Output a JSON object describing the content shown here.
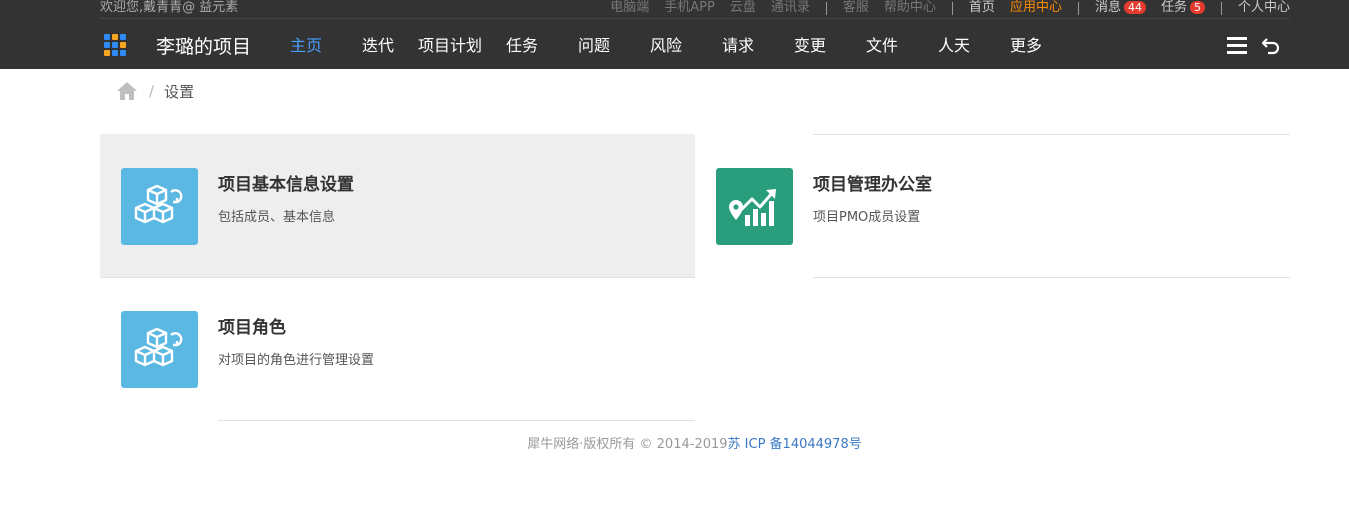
{
  "header": {
    "welcome": "欢迎您,戴青青@ 益元素",
    "links_group1": [
      "电脑端",
      "手机APP",
      "云盘",
      "通讯录"
    ],
    "links_group2": [
      "客服",
      "帮助中心"
    ],
    "home": "首页",
    "app_center": "应用中心",
    "messages_label": "消息",
    "messages_count": "44",
    "tasks_label": "任务",
    "tasks_count": "5",
    "personal_center": "个人中心"
  },
  "nav": {
    "project_title": "李璐的项目",
    "items": [
      "主页",
      "迭代",
      "项目计划",
      "任务",
      "问题",
      "风险",
      "请求",
      "变更",
      "文件",
      "人天",
      "更多"
    ],
    "active_index": 0,
    "grid_icon_colors": [
      "#2f8bf5",
      "#f5a623",
      "#2f8bf5",
      "#2f8bf5",
      "#2f8bf5",
      "#f5a623",
      "#f5a623",
      "#2f8bf5",
      "#2f8bf5"
    ]
  },
  "breadcrumb": {
    "sep": "/",
    "current": "设置"
  },
  "cards": [
    {
      "title": "项目基本信息设置",
      "desc": "包括成员、基本信息",
      "icon": "cubes-icon",
      "color": "#5bb8e3"
    },
    {
      "title": "项目管理办公室",
      "desc": "项目PMO成员设置",
      "icon": "chart-pin-icon",
      "color": "#2a9d7c"
    },
    {
      "title": "项目角色",
      "desc": "对项目的角色进行管理设置",
      "icon": "cubes-icon",
      "color": "#5bb8e3"
    }
  ],
  "footer": {
    "text": "犀牛网络·版权所有 © 2014-2019",
    "icp": "苏 ICP 备14044978号"
  },
  "colors": {
    "topbar_bg": "#333333",
    "nav_active": "#4a9eff",
    "app_center": "#ff8a00",
    "badge": "#e53b2f",
    "card_hover_bg": "#eeeeee",
    "link": "#3b78c4"
  }
}
